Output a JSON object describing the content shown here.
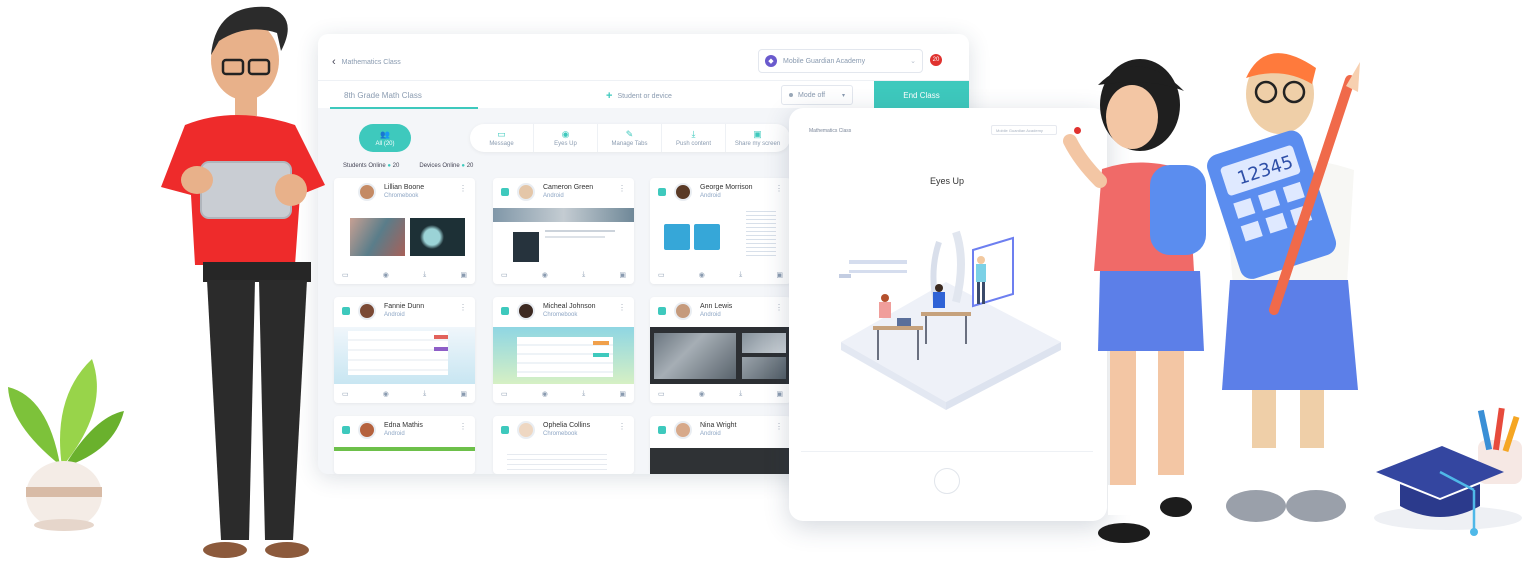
{
  "dashboard": {
    "back_label": "Mathematics Class",
    "organization": "Mobile Guardian Academy",
    "notification_count": "20",
    "class_tab": "8th Grade Math Class",
    "add_student": "Student or device",
    "mode": "Mode off",
    "end_class": "End Class",
    "filter_all": "All (20)",
    "toolbar": [
      "Message",
      "Eyes Up",
      "Manage Tabs",
      "Push content",
      "Share my screen"
    ],
    "students_online_label": "Students Online",
    "students_online_count": "20",
    "devices_online_label": "Devices Online",
    "devices_online_count": "20",
    "students": [
      {
        "name": "Lillian Boone",
        "device": "Chromebook"
      },
      {
        "name": "Cameron Green",
        "device": "Android"
      },
      {
        "name": "George Morrison",
        "device": "Android"
      },
      {
        "name": "Fannie Dunn",
        "device": "Android"
      },
      {
        "name": "Micheal Johnson",
        "device": "Chromebook"
      },
      {
        "name": "Ann Lewis",
        "device": "Android"
      },
      {
        "name": "Edna Mathis",
        "device": "Android"
      },
      {
        "name": "Ophelia Collins",
        "device": "Chromebook"
      },
      {
        "name": "Nina Wright",
        "device": "Android"
      }
    ]
  },
  "tablet": {
    "header": "Mathematics Class",
    "organization": "Mobile Guardian Academy",
    "title": "Eyes Up"
  },
  "colors": {
    "accent": "#3ec9bd",
    "alert": "#e0322f",
    "shirt_red": "#ee2b2b"
  },
  "icons": [
    "chevron-left-icon",
    "shield-icon",
    "plus-icon",
    "users-icon",
    "message-icon",
    "eye-icon",
    "edit-icon",
    "download-icon",
    "video-icon",
    "kebab-icon"
  ]
}
